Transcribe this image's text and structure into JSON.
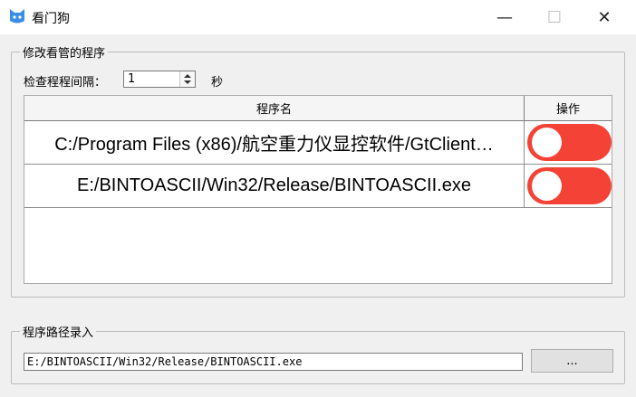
{
  "window": {
    "title": "看门狗",
    "min_symbol": "—",
    "max_symbol": "☐",
    "close_symbol": "✕"
  },
  "colors": {
    "toggle_on": "#f44336",
    "accent": "#3a8ee6"
  },
  "edit_group": {
    "legend": "修改看管的程序",
    "interval_label": "检查程程间隔：",
    "interval_value": "1",
    "interval_unit": "秒",
    "table": {
      "headers": {
        "name": "程序名",
        "operation": "操作"
      },
      "rows": [
        {
          "name": "C:/Program Files (x86)/航空重力仪显控软件/GtClient…",
          "enabled": true
        },
        {
          "name": "E:/BINTOASCII/Win32/Release/BINTOASCII.exe",
          "enabled": true
        }
      ]
    }
  },
  "path_group": {
    "legend": "程序路径录入",
    "path_value": "E:/BINTOASCII/Win32/Release/BINTOASCII.exe",
    "browse_label": "..."
  }
}
